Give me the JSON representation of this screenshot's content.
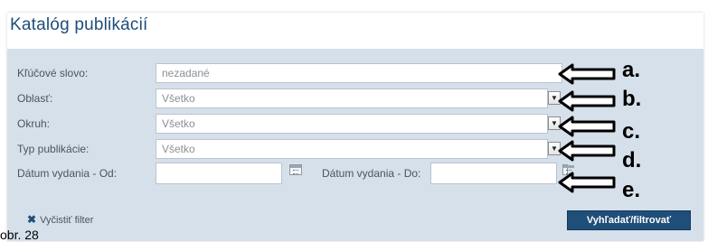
{
  "page_title": "Katalóg publikácií",
  "form": {
    "keyword": {
      "label": "Kľúčové slovo:",
      "value": "nezadané"
    },
    "area": {
      "label": "Oblasť:",
      "value": "Všetko"
    },
    "scope": {
      "label": "Okruh:",
      "value": "Všetko"
    },
    "pub_type": {
      "label": "Typ publikácie:",
      "value": "Všetko"
    },
    "date_from": {
      "label": "Dátum vydania - Od:",
      "value": ""
    },
    "date_to": {
      "label": "Dátum vydania - Do:",
      "value": ""
    }
  },
  "actions": {
    "clear_label": "Vyčistiť filter",
    "search_label": "Vyhľadať/filtrovať"
  },
  "annotations": {
    "markers": [
      "a.",
      "b.",
      "c.",
      "d.",
      "e."
    ],
    "caption": "obr. 28"
  },
  "icons": {
    "select_arrow": "chevron-down-icon",
    "calendar": "calendar-icon",
    "clear": "close-icon",
    "pointer": "left-arrow-icon"
  },
  "colors": {
    "title": "#1f4e79",
    "form_background": "#d6e0ea",
    "button": "#1f4e79"
  }
}
